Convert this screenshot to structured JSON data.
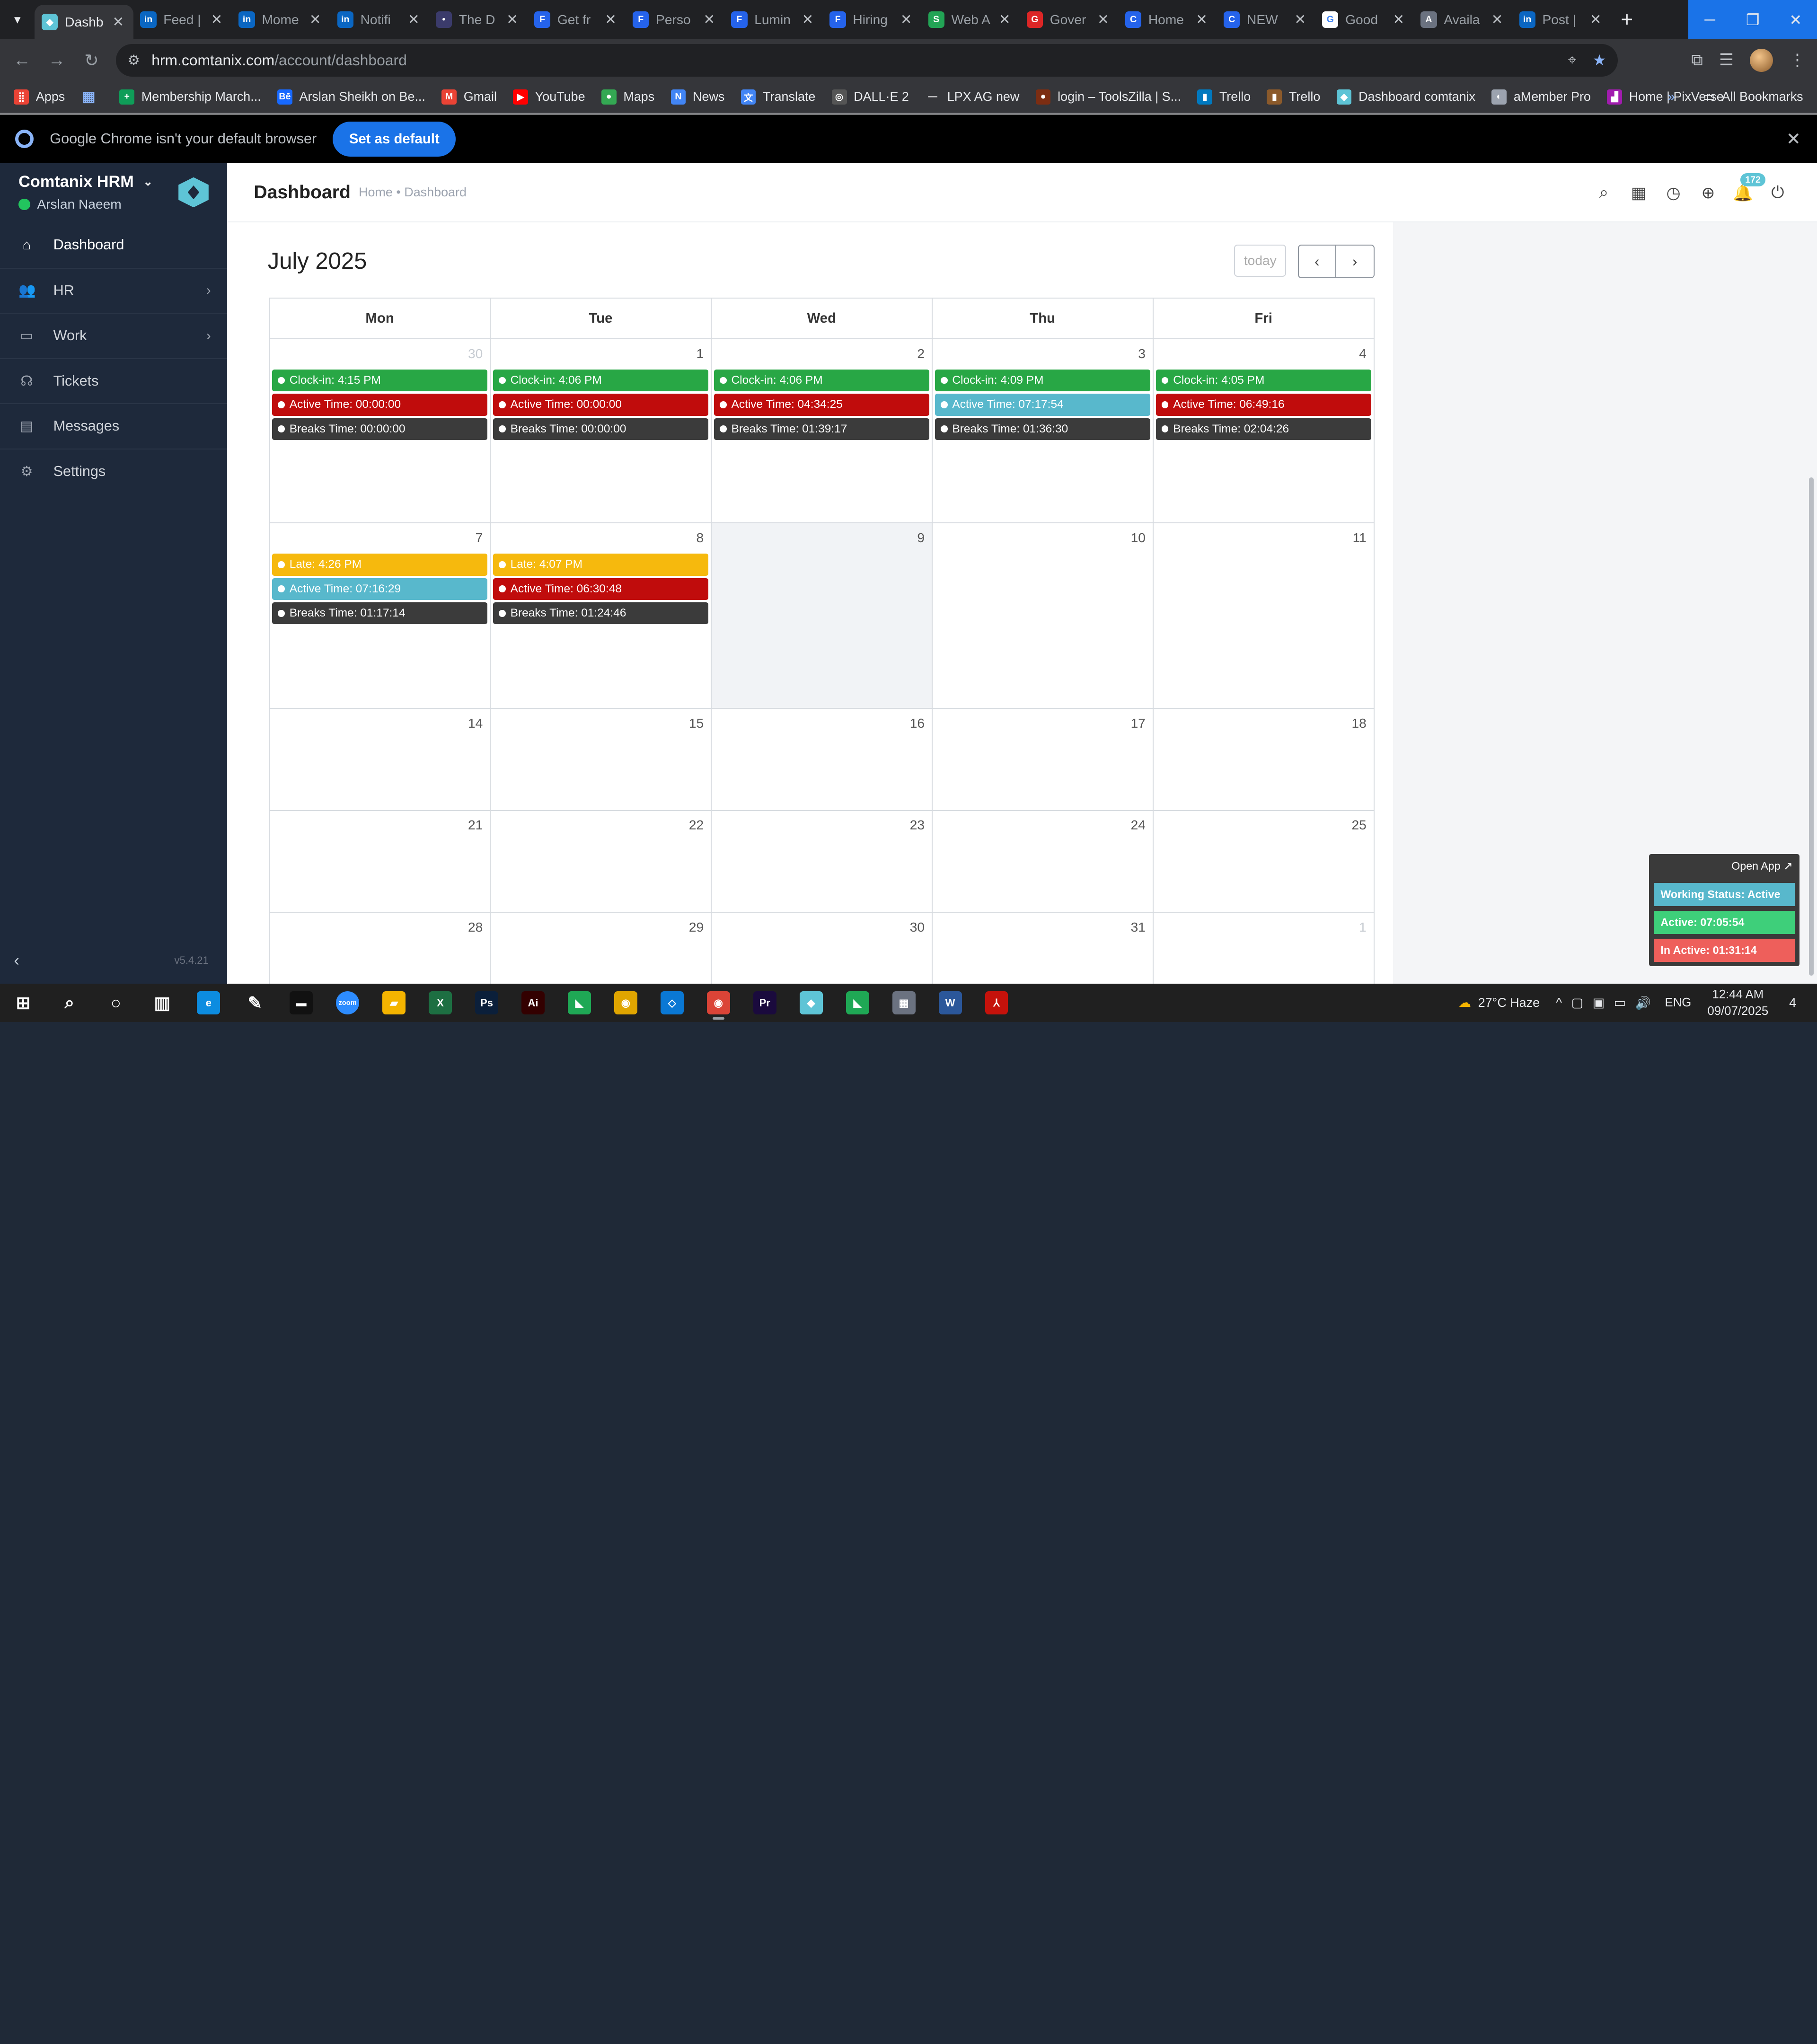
{
  "browser": {
    "tabs": [
      {
        "label": "Dashb",
        "icon": "comtanix",
        "color": "#5ec4d6",
        "active": true
      },
      {
        "label": "Feed |",
        "icon": "in",
        "color": "#0a66c2"
      },
      {
        "label": "Mome",
        "icon": "in",
        "color": "#0a66c2"
      },
      {
        "label": "Notifi",
        "icon": "in",
        "color": "#0a66c2"
      },
      {
        "label": "The D",
        "icon": "dot",
        "color": "#3b3b6b"
      },
      {
        "label": "Get fr",
        "icon": "F",
        "color": "#2563eb"
      },
      {
        "label": "Perso",
        "icon": "F",
        "color": "#2563eb"
      },
      {
        "label": "Lumin",
        "icon": "F",
        "color": "#2563eb"
      },
      {
        "label": "Hiring",
        "icon": "F",
        "color": "#2563eb"
      },
      {
        "label": "Web A",
        "icon": "S",
        "color": "#22a455"
      },
      {
        "label": "Gover",
        "icon": "G",
        "color": "#dc2626"
      },
      {
        "label": "Home",
        "icon": "C",
        "color": "#2563eb"
      },
      {
        "label": "NEW",
        "icon": "C",
        "color": "#2563eb"
      },
      {
        "label": "Good",
        "icon": "G",
        "color": "#ffffff"
      },
      {
        "label": "Availa",
        "icon": "A",
        "color": "#6b7280"
      },
      {
        "label": "Post |",
        "icon": "in",
        "color": "#0a66c2"
      }
    ],
    "url_host": "hrm.comtanix.com",
    "url_path": "/account/dashboard",
    "bookmarks": [
      {
        "label": "Apps",
        "color": "#ea4335",
        "icon": "grid"
      },
      {
        "label": "",
        "color": "#1a73e8",
        "icon": "grid2"
      },
      {
        "label": "Membership March...",
        "color": "#0f9d58",
        "icon": "+"
      },
      {
        "label": "Arslan Sheikh on Be...",
        "color": "#1769ff",
        "icon": "Bē"
      },
      {
        "label": "Gmail",
        "color": "#ea4335",
        "icon": "M"
      },
      {
        "label": "YouTube",
        "color": "#ff0000",
        "icon": "▶"
      },
      {
        "label": "Maps",
        "color": "#34a853",
        "icon": "●"
      },
      {
        "label": "News",
        "color": "#4285f4",
        "icon": "N"
      },
      {
        "label": "Translate",
        "color": "#4285f4",
        "icon": "文"
      },
      {
        "label": "DALL·E 2",
        "color": "#555555",
        "icon": "◎"
      },
      {
        "label": "LPX AG new",
        "color": "#35363a",
        "icon": "—"
      },
      {
        "label": "login – ToolsZilla | S...",
        "color": "#7c2d12",
        "icon": "●"
      },
      {
        "label": "Trello",
        "color": "#0079bf",
        "icon": "▮"
      },
      {
        "label": "Trello",
        "color": "#8b5a2b",
        "icon": "▮"
      },
      {
        "label": "Dashboard comtanix",
        "color": "#5ec4d6",
        "icon": "◆"
      },
      {
        "label": "aMember Pro",
        "color": "#9ca3af",
        "icon": "◐"
      },
      {
        "label": "Home | PixVerse",
        "color": "#a21caf",
        "icon": "▟"
      }
    ],
    "all_bookmarks": "All Bookmarks",
    "infobar_text": "Google Chrome isn't your default browser",
    "infobar_button": "Set as default"
  },
  "sidebar": {
    "brand": "Comtanix HRM",
    "user": "Arslan Naeem",
    "items": [
      {
        "label": "Dashboard",
        "icon": "home-icon",
        "glyph": "⌂",
        "active": true,
        "chevron": false
      },
      {
        "label": "HR",
        "icon": "users-icon",
        "glyph": "👥",
        "active": false,
        "chevron": true
      },
      {
        "label": "Work",
        "icon": "briefcase-icon",
        "glyph": "▭",
        "active": false,
        "chevron": true
      },
      {
        "label": "Tickets",
        "icon": "headset-icon",
        "glyph": "☊",
        "active": false,
        "chevron": false
      },
      {
        "label": "Messages",
        "icon": "message-icon",
        "glyph": "▤",
        "active": false,
        "chevron": false
      },
      {
        "label": "Settings",
        "icon": "gear-icon",
        "glyph": "⚙",
        "active": false,
        "chevron": false
      }
    ],
    "version": "v5.4.21"
  },
  "header": {
    "title": "Dashboard",
    "breadcrumb": "Home • Dashboard",
    "notification_count": "172"
  },
  "calendar": {
    "title": "July 2025",
    "today_label": "today",
    "weekdays": [
      "Mon",
      "Tue",
      "Wed",
      "Thu",
      "Fri"
    ],
    "weeks": [
      {
        "days": [
          {
            "num": "30",
            "other": true,
            "events": [
              {
                "text": "Clock-in: 4:15 PM",
                "kind": "green"
              },
              {
                "text": "Active Time: 00:00:00",
                "kind": "red"
              },
              {
                "text": "Breaks Time: 00:00:00",
                "kind": "dark"
              }
            ]
          },
          {
            "num": "1",
            "events": [
              {
                "text": "Clock-in: 4:06 PM",
                "kind": "green"
              },
              {
                "text": "Active Time: 00:00:00",
                "kind": "red"
              },
              {
                "text": "Breaks Time: 00:00:00",
                "kind": "dark"
              }
            ]
          },
          {
            "num": "2",
            "events": [
              {
                "text": "Clock-in: 4:06 PM",
                "kind": "green"
              },
              {
                "text": "Active Time: 04:34:25",
                "kind": "red"
              },
              {
                "text": "Breaks Time: 01:39:17",
                "kind": "dark"
              }
            ]
          },
          {
            "num": "3",
            "events": [
              {
                "text": "Clock-in: 4:09 PM",
                "kind": "green"
              },
              {
                "text": "Active Time: 07:17:54",
                "kind": "teal"
              },
              {
                "text": "Breaks Time: 01:36:30",
                "kind": "dark"
              }
            ]
          },
          {
            "num": "4",
            "events": [
              {
                "text": "Clock-in: 4:05 PM",
                "kind": "green"
              },
              {
                "text": "Active Time: 06:49:16",
                "kind": "red"
              },
              {
                "text": "Breaks Time: 02:04:26",
                "kind": "dark"
              }
            ]
          }
        ]
      },
      {
        "days": [
          {
            "num": "7",
            "events": [
              {
                "text": "Late: 4:26 PM",
                "kind": "yellow"
              },
              {
                "text": "Active Time: 07:16:29",
                "kind": "teal"
              },
              {
                "text": "Breaks Time: 01:17:14",
                "kind": "dark"
              }
            ]
          },
          {
            "num": "8",
            "events": [
              {
                "text": "Late: 4:07 PM",
                "kind": "yellow"
              },
              {
                "text": "Active Time: 06:30:48",
                "kind": "red"
              },
              {
                "text": "Breaks Time: 01:24:46",
                "kind": "dark"
              }
            ]
          },
          {
            "num": "9",
            "today": true,
            "events": []
          },
          {
            "num": "10",
            "events": []
          },
          {
            "num": "11",
            "events": []
          }
        ]
      },
      {
        "days": [
          {
            "num": "14",
            "events": []
          },
          {
            "num": "15",
            "events": []
          },
          {
            "num": "16",
            "events": []
          },
          {
            "num": "17",
            "events": []
          },
          {
            "num": "18",
            "events": []
          }
        ]
      },
      {
        "days": [
          {
            "num": "21",
            "events": []
          },
          {
            "num": "22",
            "events": []
          },
          {
            "num": "23",
            "events": []
          },
          {
            "num": "24",
            "events": []
          },
          {
            "num": "25",
            "events": []
          }
        ]
      },
      {
        "days": [
          {
            "num": "28",
            "events": []
          },
          {
            "num": "29",
            "events": []
          },
          {
            "num": "30",
            "events": []
          },
          {
            "num": "31",
            "events": []
          },
          {
            "num": "1",
            "other": true,
            "events": []
          }
        ]
      }
    ]
  },
  "status_widget": {
    "open_app": "Open App ↗",
    "working_status": "Working Status: Active",
    "active": "Active: 07:05:54",
    "inactive": "In Active: 01:31:14",
    "colors": {
      "status": "#58b8cc",
      "active": "#3ecf7a",
      "inactive": "#ee5f5b"
    }
  },
  "taskbar": {
    "apps": [
      {
        "name": "windows-start-icon",
        "glyph": "⊞",
        "color": "transparent"
      },
      {
        "name": "search-icon",
        "glyph": "⌕",
        "color": "transparent"
      },
      {
        "name": "cortana-icon",
        "glyph": "○",
        "color": "transparent"
      },
      {
        "name": "task-view-icon",
        "glyph": "▥",
        "color": "transparent"
      },
      {
        "name": "edge-icon",
        "glyph": "e",
        "color": "#0c8ce0"
      },
      {
        "name": "pen-icon",
        "glyph": "✎",
        "color": "transparent"
      },
      {
        "name": "terminal-icon",
        "glyph": "▬",
        "color": "#111111"
      },
      {
        "name": "zoom-icon",
        "glyph": "zoom",
        "color": "#2d8cff"
      },
      {
        "name": "file-explorer-icon",
        "glyph": "▰",
        "color": "#f4b400"
      },
      {
        "name": "excel-icon",
        "glyph": "X",
        "color": "#1d6f42"
      },
      {
        "name": "photoshop-icon",
        "glyph": "Ps",
        "color": "#0b1f3a"
      },
      {
        "name": "illustrator-icon",
        "glyph": "Ai",
        "color": "#330000"
      },
      {
        "name": "green-app-icon",
        "glyph": "◣",
        "color": "#1fa855"
      },
      {
        "name": "chrome-icon",
        "glyph": "◉",
        "color": "#e0a500"
      },
      {
        "name": "vscode-icon",
        "glyph": "◇",
        "color": "#0a78d4"
      },
      {
        "name": "chrome-active-icon",
        "glyph": "◉",
        "color": "#db4437",
        "open": true
      },
      {
        "name": "premiere-icon",
        "glyph": "Pr",
        "color": "#1a0a3d"
      },
      {
        "name": "comtanix-icon",
        "glyph": "◆",
        "color": "#5ec4d6"
      },
      {
        "name": "green-app-2-icon",
        "glyph": "◣",
        "color": "#1fa855"
      },
      {
        "name": "calculator-icon",
        "glyph": "▦",
        "color": "#6b7280"
      },
      {
        "name": "word-icon",
        "glyph": "W",
        "color": "#2b579a"
      },
      {
        "name": "acrobat-icon",
        "glyph": "⅄",
        "color": "#c5120b"
      }
    ],
    "weather": "27°C Haze",
    "lang": "ENG",
    "time": "12:44 AM",
    "date": "09/07/2025",
    "notif_count": "4"
  }
}
